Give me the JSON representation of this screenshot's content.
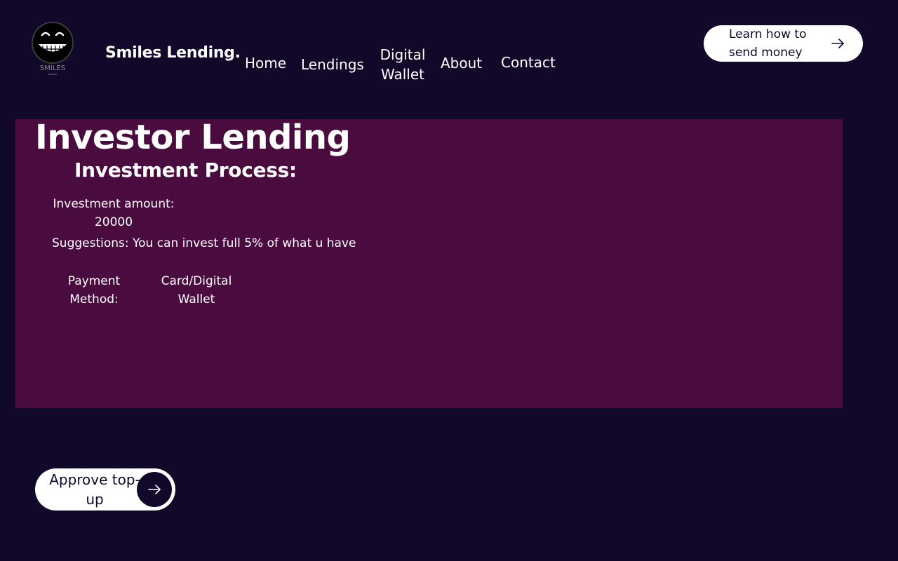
{
  "header": {
    "logo_text": "SMILES",
    "brand": "Smiles Lending.",
    "nav": {
      "home": "Home",
      "lendings": "Lendings",
      "digital_wallet": "Digital Wallet",
      "about": "About",
      "contact": "Contact"
    },
    "learn_button": "Learn how to send money"
  },
  "main": {
    "title": "Investor Lending",
    "subtitle": "Investment Process:",
    "investment_amount_label": "Investment amount:",
    "investment_amount_value": "20000",
    "suggestions": "Suggestions: You can invest full 5% of what u have",
    "payment_method_label": "Payment Method:",
    "payment_method_value": "Card/Digital Wallet"
  },
  "actions": {
    "approve_button": "Approve top-up"
  },
  "colors": {
    "background": "#12082a",
    "panel": "#4a0c3e",
    "button_bg": "#ffffff",
    "button_text": "#12082a"
  },
  "icons": {
    "logo": "smiling-face-logo-icon",
    "learn_arrow": "arrow-right-icon",
    "approve_arrow": "arrow-right-icon"
  }
}
